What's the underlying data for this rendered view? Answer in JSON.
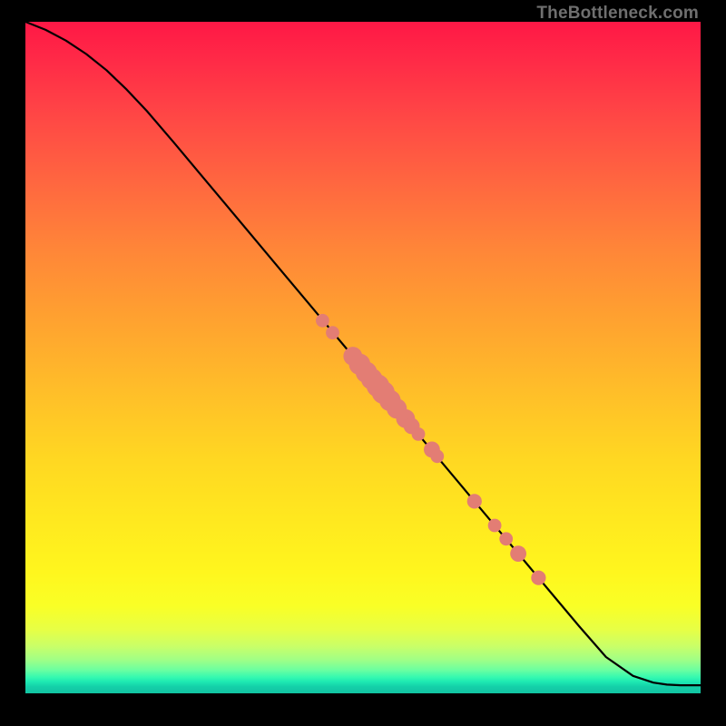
{
  "watermark": "TheBottleneck.com",
  "colors": {
    "curve": "#000000",
    "points": "#e37d74"
  },
  "chart_data": {
    "type": "line",
    "title": "",
    "xlabel": "",
    "ylabel": "",
    "xlim": [
      0,
      100
    ],
    "ylim": [
      0,
      100
    ],
    "grid": false,
    "series": [
      {
        "name": "curve",
        "x": [
          0,
          3,
          6,
          9,
          12,
          15,
          18,
          22,
          26,
          30,
          34,
          38,
          42,
          46,
          50,
          54,
          58,
          62,
          66,
          70,
          74,
          78,
          82,
          86,
          90,
          93,
          95,
          97,
          100
        ],
        "y": [
          100,
          98.8,
          97.2,
          95.2,
          92.8,
          89.9,
          86.7,
          82.0,
          77.2,
          72.4,
          67.6,
          62.8,
          58.0,
          53.2,
          48.4,
          43.6,
          38.8,
          34.0,
          29.2,
          24.4,
          19.6,
          14.8,
          10.0,
          5.4,
          2.6,
          1.6,
          1.3,
          1.2,
          1.2
        ]
      }
    ],
    "points": [
      {
        "x": 44.0,
        "y": 55.5,
        "r": 1.0
      },
      {
        "x": 45.5,
        "y": 53.7,
        "r": 1.0
      },
      {
        "x": 48.5,
        "y": 50.2,
        "r": 1.4
      },
      {
        "x": 49.5,
        "y": 49.0,
        "r": 1.6
      },
      {
        "x": 50.5,
        "y": 47.8,
        "r": 1.6
      },
      {
        "x": 51.3,
        "y": 46.8,
        "r": 1.6
      },
      {
        "x": 52.2,
        "y": 45.8,
        "r": 1.7
      },
      {
        "x": 53.0,
        "y": 44.8,
        "r": 1.7
      },
      {
        "x": 54.0,
        "y": 43.6,
        "r": 1.6
      },
      {
        "x": 55.0,
        "y": 42.4,
        "r": 1.5
      },
      {
        "x": 56.3,
        "y": 40.9,
        "r": 1.4
      },
      {
        "x": 57.2,
        "y": 39.8,
        "r": 1.2
      },
      {
        "x": 58.2,
        "y": 38.6,
        "r": 1.0
      },
      {
        "x": 60.2,
        "y": 36.3,
        "r": 1.2
      },
      {
        "x": 61.0,
        "y": 35.3,
        "r": 1.0
      },
      {
        "x": 66.5,
        "y": 28.6,
        "r": 1.1
      },
      {
        "x": 69.5,
        "y": 25.0,
        "r": 1.0
      },
      {
        "x": 71.2,
        "y": 23.0,
        "r": 1.0
      },
      {
        "x": 73.0,
        "y": 20.8,
        "r": 1.2
      },
      {
        "x": 76.0,
        "y": 17.2,
        "r": 1.1
      }
    ]
  }
}
